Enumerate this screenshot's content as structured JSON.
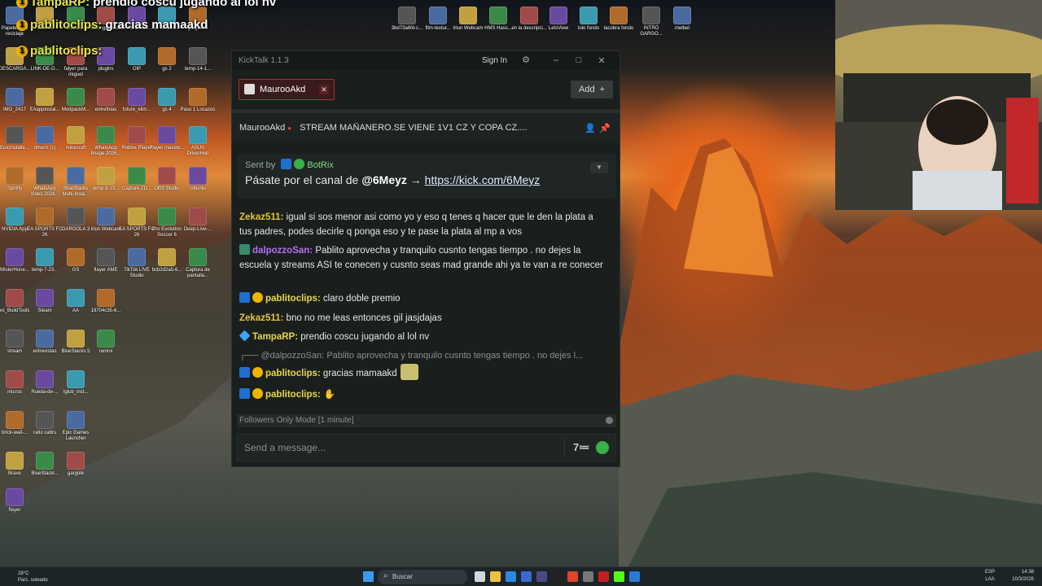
{
  "overlay": {
    "lines": [
      {
        "name": "TampaRP:",
        "text": " prendio coscu jugando al lol nv"
      },
      {
        "name": "pablitoclips:",
        "text": " gracias mamaakd"
      },
      {
        "name": "pablitoclips:",
        "text": ""
      }
    ]
  },
  "desktop_icons": [
    "Papelera de reciclaje",
    "carrera",
    "Locazos",
    "Bazinga fondo",
    "1770510283...",
    "17704925...",
    "gargola 2",
    "3bd73a6fd-c...",
    "film-textur...",
    "Iriun Webcam",
    "HMS Hass...",
    "en la descripci...",
    "LetsView",
    "lolo fondo",
    "lacobra fondo",
    "INTRO GARGO...",
    "melbet",
    "DESCARGA...",
    "LINK-DE-D...",
    "falyer para miguel",
    "plugins",
    "OIP",
    "gs 2",
    "temp-14-1...",
    "IMG_2417",
    "EAappinstal...",
    "ModpackM...",
    "entrefotas",
    "future_elim...",
    "gs 4",
    "Paso 1 Locazos",
    "EpicInstalle...",
    "drivers (1)",
    "minecraft",
    "WhatsApp Image 2026...",
    "Roblox Player",
    "Player macete...",
    "ASUS DriverHub",
    "Spotify",
    "WhatsApp Video 2026...",
    "BlueStacks Multi-Insta...",
    "temp-9-13...",
    "Capture ZD...",
    "OBS Studio",
    "Ubuntu",
    "NVIDIA App",
    "EA SPORTS FC 26",
    "GARGOLA 3",
    "Iriun Webcam",
    "EA SPORTS FC 26",
    "Pro Evolution Soccer 6",
    "Deep-Live-...",
    "MisterHone...",
    "temp-7-23...",
    "GS",
    "flayer AME",
    "TikTok LIVE Studio",
    "bcb2d2a5-6...",
    "Captura de pantalla...",
    "vs_BuildTools",
    "Steam",
    "AA",
    "19704c35-6...",
    "stream",
    "entrevistas",
    "BlueStacks 5",
    "remini",
    "micros",
    "Rueda-de-...",
    "Iglub_inst...",
    "brick-wall-...",
    "ratio cattrs",
    "Epic Games Launcher",
    "Brave",
    "BlueStackl...",
    "gargole",
    "flayer"
  ],
  "kicktalk": {
    "app_title": "KickTalk 1.1.3",
    "sign_in": "Sign In",
    "tab_label": "MaurooAkd",
    "add_label": "Add",
    "stream_user": "MaurooAkd",
    "stream_title": "STREAM MAÑANERO.SE VIENE 1V1 CZ Y COPA CZ....",
    "pinned": {
      "sent_by_prefix": "Sent by",
      "sent_by_name": "BotRix",
      "message_prefix": "Pásate por el canal de ",
      "message_mention": "@6Meyz",
      "message_arrow": " → ",
      "message_link": "https://kick.com/6Meyz"
    },
    "messages": [
      {
        "user": "Zekaz511:",
        "text": " igual si sos menor asi como yo y eso q tenes q hacer que le den la plata a tus padres, podes decirle q ponga eso y te pase la plata al mp a vos"
      },
      {
        "user": "dalpozzoSan:",
        "text": " Pablito aprovecha y tranquilo cusnto tengas tiempo . no dejes la escuela y streams ASI te conecen y cusnto seas mad grande ahi ya te van a re conecer"
      },
      {
        "user": "pablitoclips:",
        "text": " claro doble premio"
      },
      {
        "user": "Zekaz511:",
        "text": " bno no me leas entonces gil jasjdajas"
      },
      {
        "user": "TampaRP:",
        "text": " prendio coscu jugando al lol nv"
      },
      {
        "reply": "@dalpozzoSan: Pablito aprovecha y tranquilo cusnto tengas tiempo . no dejes l..."
      },
      {
        "user": "pablitoclips:",
        "text": " gracias mamaakd"
      },
      {
        "user": "pablitoclips:",
        "text": ""
      }
    ],
    "status_text": "Followers Only Mode [1 minute]",
    "input_placeholder": "Send a message..."
  },
  "taskbar": {
    "weather_temp": "28°C",
    "weather_desc": "Parc. soleado",
    "search_label": "Buscar",
    "lang_top": "ESP",
    "lang_bottom": "LAA",
    "time": "14:38",
    "date": "10/3/2026"
  },
  "colors": {
    "kick_green": "#53fc18",
    "window_bg": "#1a1f1d",
    "tab_accent": "#a53030"
  }
}
